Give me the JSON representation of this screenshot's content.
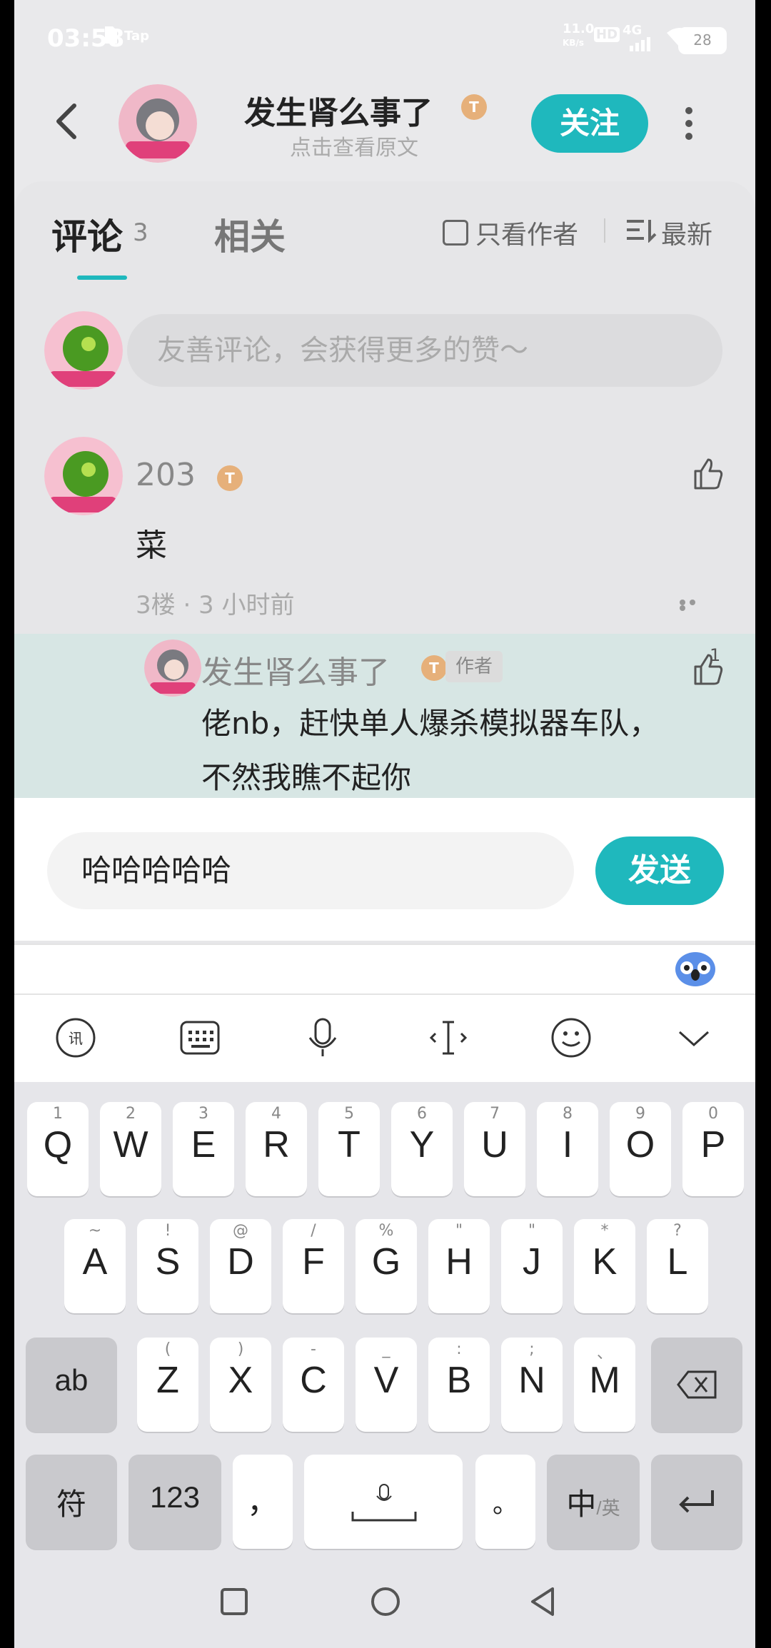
{
  "status_bar": {
    "time": "03:58",
    "net_speed": "11.0",
    "net_unit": "KB/s",
    "hd": "HD",
    "network": "4G",
    "battery": "28",
    "app_icons": [
      "sim-icon",
      "tap-icon"
    ]
  },
  "header": {
    "title": "发生肾么事了",
    "subtitle": "点击查看原文",
    "level_badge": "T",
    "follow_label": "关注"
  },
  "tabs": {
    "comments_label": "评论",
    "comments_count": "3",
    "related_label": "相关",
    "only_author_label": "只看作者",
    "sort_label": "最新"
  },
  "comment_box": {
    "placeholder": "友善评论，会获得更多的赞～"
  },
  "comment": {
    "user": "203",
    "level_badge": "T",
    "text": "菜",
    "meta": "3楼 · 3 小时前"
  },
  "reply": {
    "user": "发生肾么事了",
    "level_badge": "T",
    "author_tag": "作者",
    "likes": "1",
    "text_line1": "佬nb，赶快单人爆杀模拟器车队，",
    "text_line2": "不然我瞧不起你"
  },
  "input": {
    "value": "哈哈哈哈哈",
    "send_label": "发送"
  },
  "keyboard": {
    "row1": [
      {
        "main": "Q",
        "sub": "1"
      },
      {
        "main": "W",
        "sub": "2"
      },
      {
        "main": "E",
        "sub": "3"
      },
      {
        "main": "R",
        "sub": "4"
      },
      {
        "main": "T",
        "sub": "5"
      },
      {
        "main": "Y",
        "sub": "6"
      },
      {
        "main": "U",
        "sub": "7"
      },
      {
        "main": "I",
        "sub": "8"
      },
      {
        "main": "O",
        "sub": "9"
      },
      {
        "main": "P",
        "sub": "0"
      }
    ],
    "row2": [
      {
        "main": "A",
        "sub": "~"
      },
      {
        "main": "S",
        "sub": "!"
      },
      {
        "main": "D",
        "sub": "@"
      },
      {
        "main": "F",
        "sub": "/"
      },
      {
        "main": "G",
        "sub": "%"
      },
      {
        "main": "H",
        "sub": "\""
      },
      {
        "main": "J",
        "sub": "\""
      },
      {
        "main": "K",
        "sub": "*"
      },
      {
        "main": "L",
        "sub": "?"
      }
    ],
    "row3": [
      {
        "main": "Z",
        "sub": "("
      },
      {
        "main": "X",
        "sub": ")"
      },
      {
        "main": "C",
        "sub": "-"
      },
      {
        "main": "V",
        "sub": "_"
      },
      {
        "main": "B",
        "sub": ":"
      },
      {
        "main": "N",
        "sub": ";"
      },
      {
        "main": "M",
        "sub": "、"
      }
    ],
    "ab_label": "ab",
    "symbol_label": "符",
    "num_label": "123",
    "comma_label": "，",
    "period_label": "。",
    "lang_label": "中",
    "lang_sub": "/英"
  }
}
